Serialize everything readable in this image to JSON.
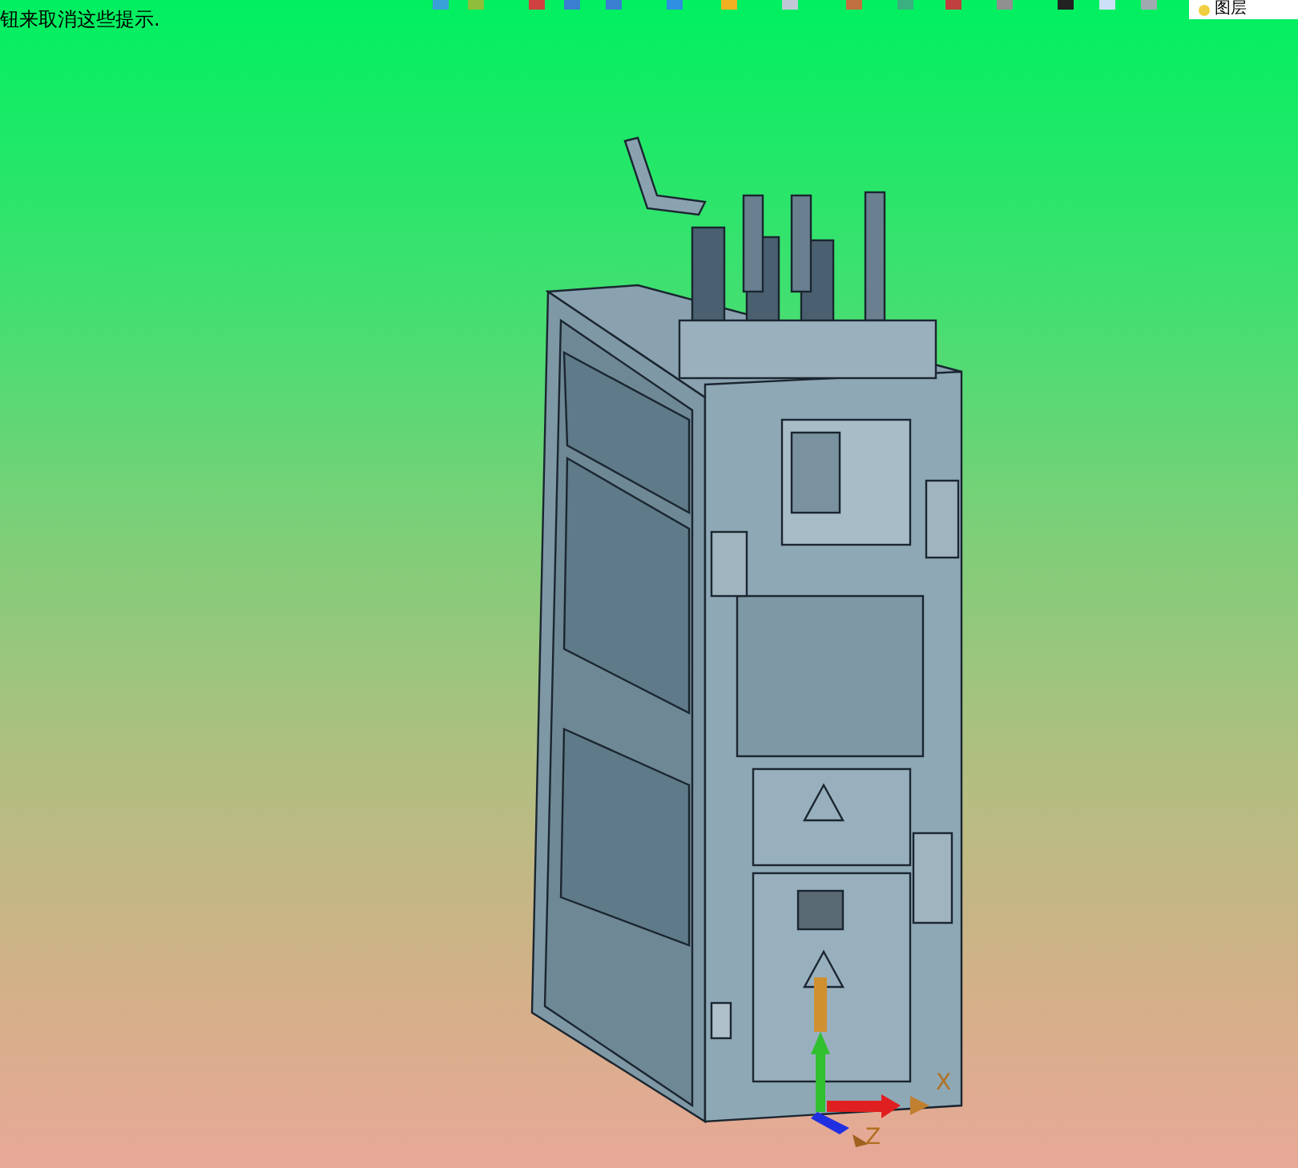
{
  "hint": {
    "text": "钮来取消这些提示."
  },
  "layer_box": {
    "value": "图层"
  },
  "triad": {
    "axes": [
      {
        "label": "X"
      },
      {
        "label": "Z"
      }
    ]
  }
}
